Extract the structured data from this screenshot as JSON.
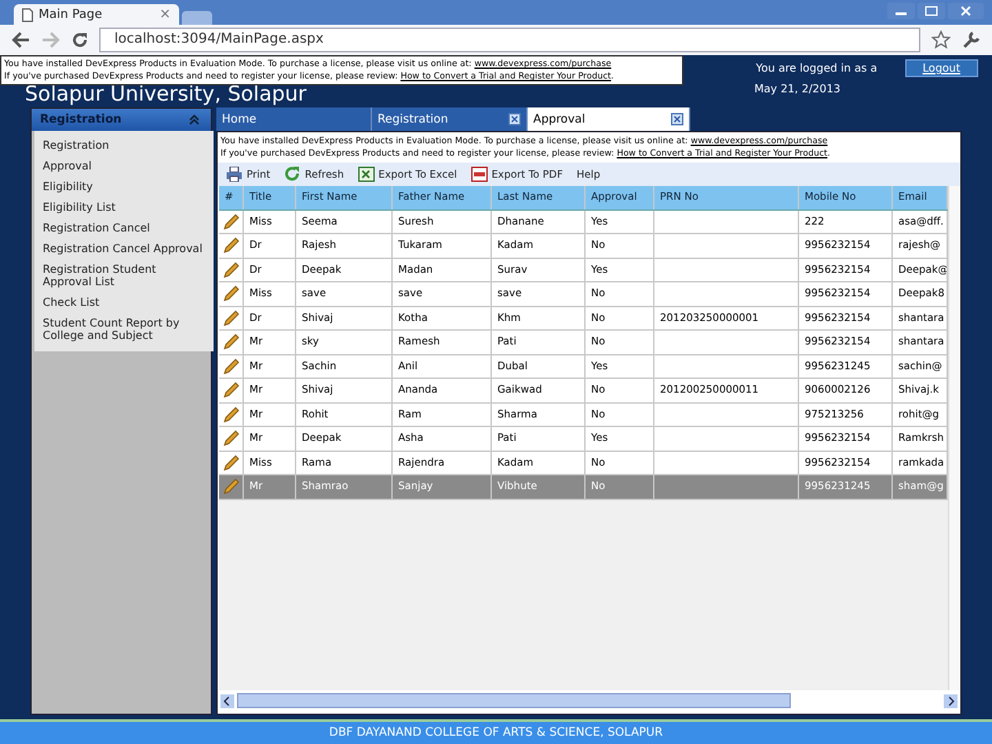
{
  "browser": {
    "tab_title": "Main Page",
    "tab_close": "×",
    "url": "localhost:3094/MainPage.aspx"
  },
  "notice": {
    "line1": "You have installed DevExpress Products in Evaluation Mode. To purchase a license, please visit us online at:",
    "link1": "www.devexpress.com/purchase",
    "line2": "If you've purchased DevExpress Products and need to register your license, please review:",
    "link2": "How to Convert a Trial and Register Your Product",
    "end": "."
  },
  "header": {
    "title": "Solapur University, Solapur",
    "logged_in": "You are logged in as a",
    "logout": "Logout",
    "date": "May 21, 2/2013"
  },
  "sidebar": {
    "title": "Registration",
    "expanded": true,
    "items": [
      {
        "label": "Registration"
      },
      {
        "label": "Approval"
      },
      {
        "label": "Eligibility"
      },
      {
        "label": "Eligibility List"
      },
      {
        "label": "Registration Cancel"
      },
      {
        "label": "Registration Cancel Approval"
      },
      {
        "label": "Registration Student Approval List"
      },
      {
        "label": "Check List"
      },
      {
        "label": "Student Count Report by College and Subject"
      }
    ]
  },
  "tabs": [
    {
      "label": "Home",
      "selected": false,
      "closable": false
    },
    {
      "label": "Registration",
      "selected": false,
      "closable": true
    },
    {
      "label": "Approval",
      "selected": true,
      "closable": true
    }
  ],
  "content_notice": {
    "line1": "You have installed DevExpress Products in Evaluation Mode. To purchase a license, please visit us online at:",
    "link1": "www.devexpress.com/purchase",
    "line2": "If you've purchased DevExpress Products and need to register your license, please review:",
    "link2": "How to Convert a Trial and Register Your Product",
    "end": "."
  },
  "toolbar": [
    {
      "kind": "print",
      "label": "Print"
    },
    {
      "kind": "refresh",
      "label": "Refresh"
    },
    {
      "kind": "excel",
      "label": "Export To Excel"
    },
    {
      "kind": "pdf",
      "label": "Export To PDF"
    },
    {
      "kind": "help",
      "label": "Help"
    }
  ],
  "table": {
    "columns": [
      "#",
      "Title",
      "First Name",
      "Father Name",
      "Last Name",
      "Approval",
      "PRN No",
      "Mobile No",
      "Email"
    ],
    "rows": [
      {
        "selected": false,
        "cells": [
          "",
          "Miss",
          "Seema",
          "Suresh",
          "Dhanane",
          "Yes",
          "",
          "222",
          "asa@dff."
        ]
      },
      {
        "selected": false,
        "cells": [
          "",
          "Dr",
          "Rajesh",
          "Tukaram",
          "Kadam",
          "No",
          "",
          "9956232154",
          "rajesh@"
        ]
      },
      {
        "selected": false,
        "cells": [
          "",
          "Dr",
          "Deepak",
          "Madan",
          "Surav",
          "Yes",
          "",
          "9956232154",
          "Deepak@"
        ]
      },
      {
        "selected": false,
        "cells": [
          "",
          "Miss",
          "save",
          "save",
          "save",
          "No",
          "",
          "9956232154",
          "Deepak8"
        ]
      },
      {
        "selected": false,
        "cells": [
          "",
          "Dr",
          "Shivaj",
          "Kotha",
          "Khm",
          "No",
          "201203250000001",
          "9956232154",
          "shantara"
        ]
      },
      {
        "selected": false,
        "cells": [
          "",
          "Mr",
          "sky",
          "Ramesh",
          "Pati",
          "No",
          "",
          "9956232154",
          "shantara"
        ]
      },
      {
        "selected": false,
        "cells": [
          "",
          "Mr",
          "Sachin",
          "Anil",
          "Dubal",
          "Yes",
          "",
          "9956231245",
          "sachin@"
        ]
      },
      {
        "selected": false,
        "cells": [
          "",
          "Mr",
          "Shivaj",
          "Ananda",
          "Gaikwad",
          "No",
          "201200250000011",
          "9060002126",
          "Shivaj.k"
        ]
      },
      {
        "selected": false,
        "cells": [
          "",
          "Mr",
          "Rohit",
          "Ram",
          "Sharma",
          "No",
          "",
          "975213256",
          "rohit@g"
        ]
      },
      {
        "selected": false,
        "cells": [
          "",
          "Mr",
          "Deepak",
          "Asha",
          "Pati",
          "Yes",
          "",
          "9956232154",
          "Ramkrsh"
        ]
      },
      {
        "selected": false,
        "cells": [
          "",
          "Miss",
          "Rama",
          "Rajendra",
          "Kadam",
          "No",
          "",
          "9956232154",
          "ramkada"
        ]
      },
      {
        "selected": true,
        "cells": [
          "",
          "Mr",
          "Shamrao",
          "Sanjay",
          "Vibhute",
          "No",
          "",
          "9956231245",
          "sham@g"
        ]
      }
    ]
  },
  "footer": "DBF DAYANAND COLLEGE OF ARTS & SCIENCE, SOLAPUR"
}
